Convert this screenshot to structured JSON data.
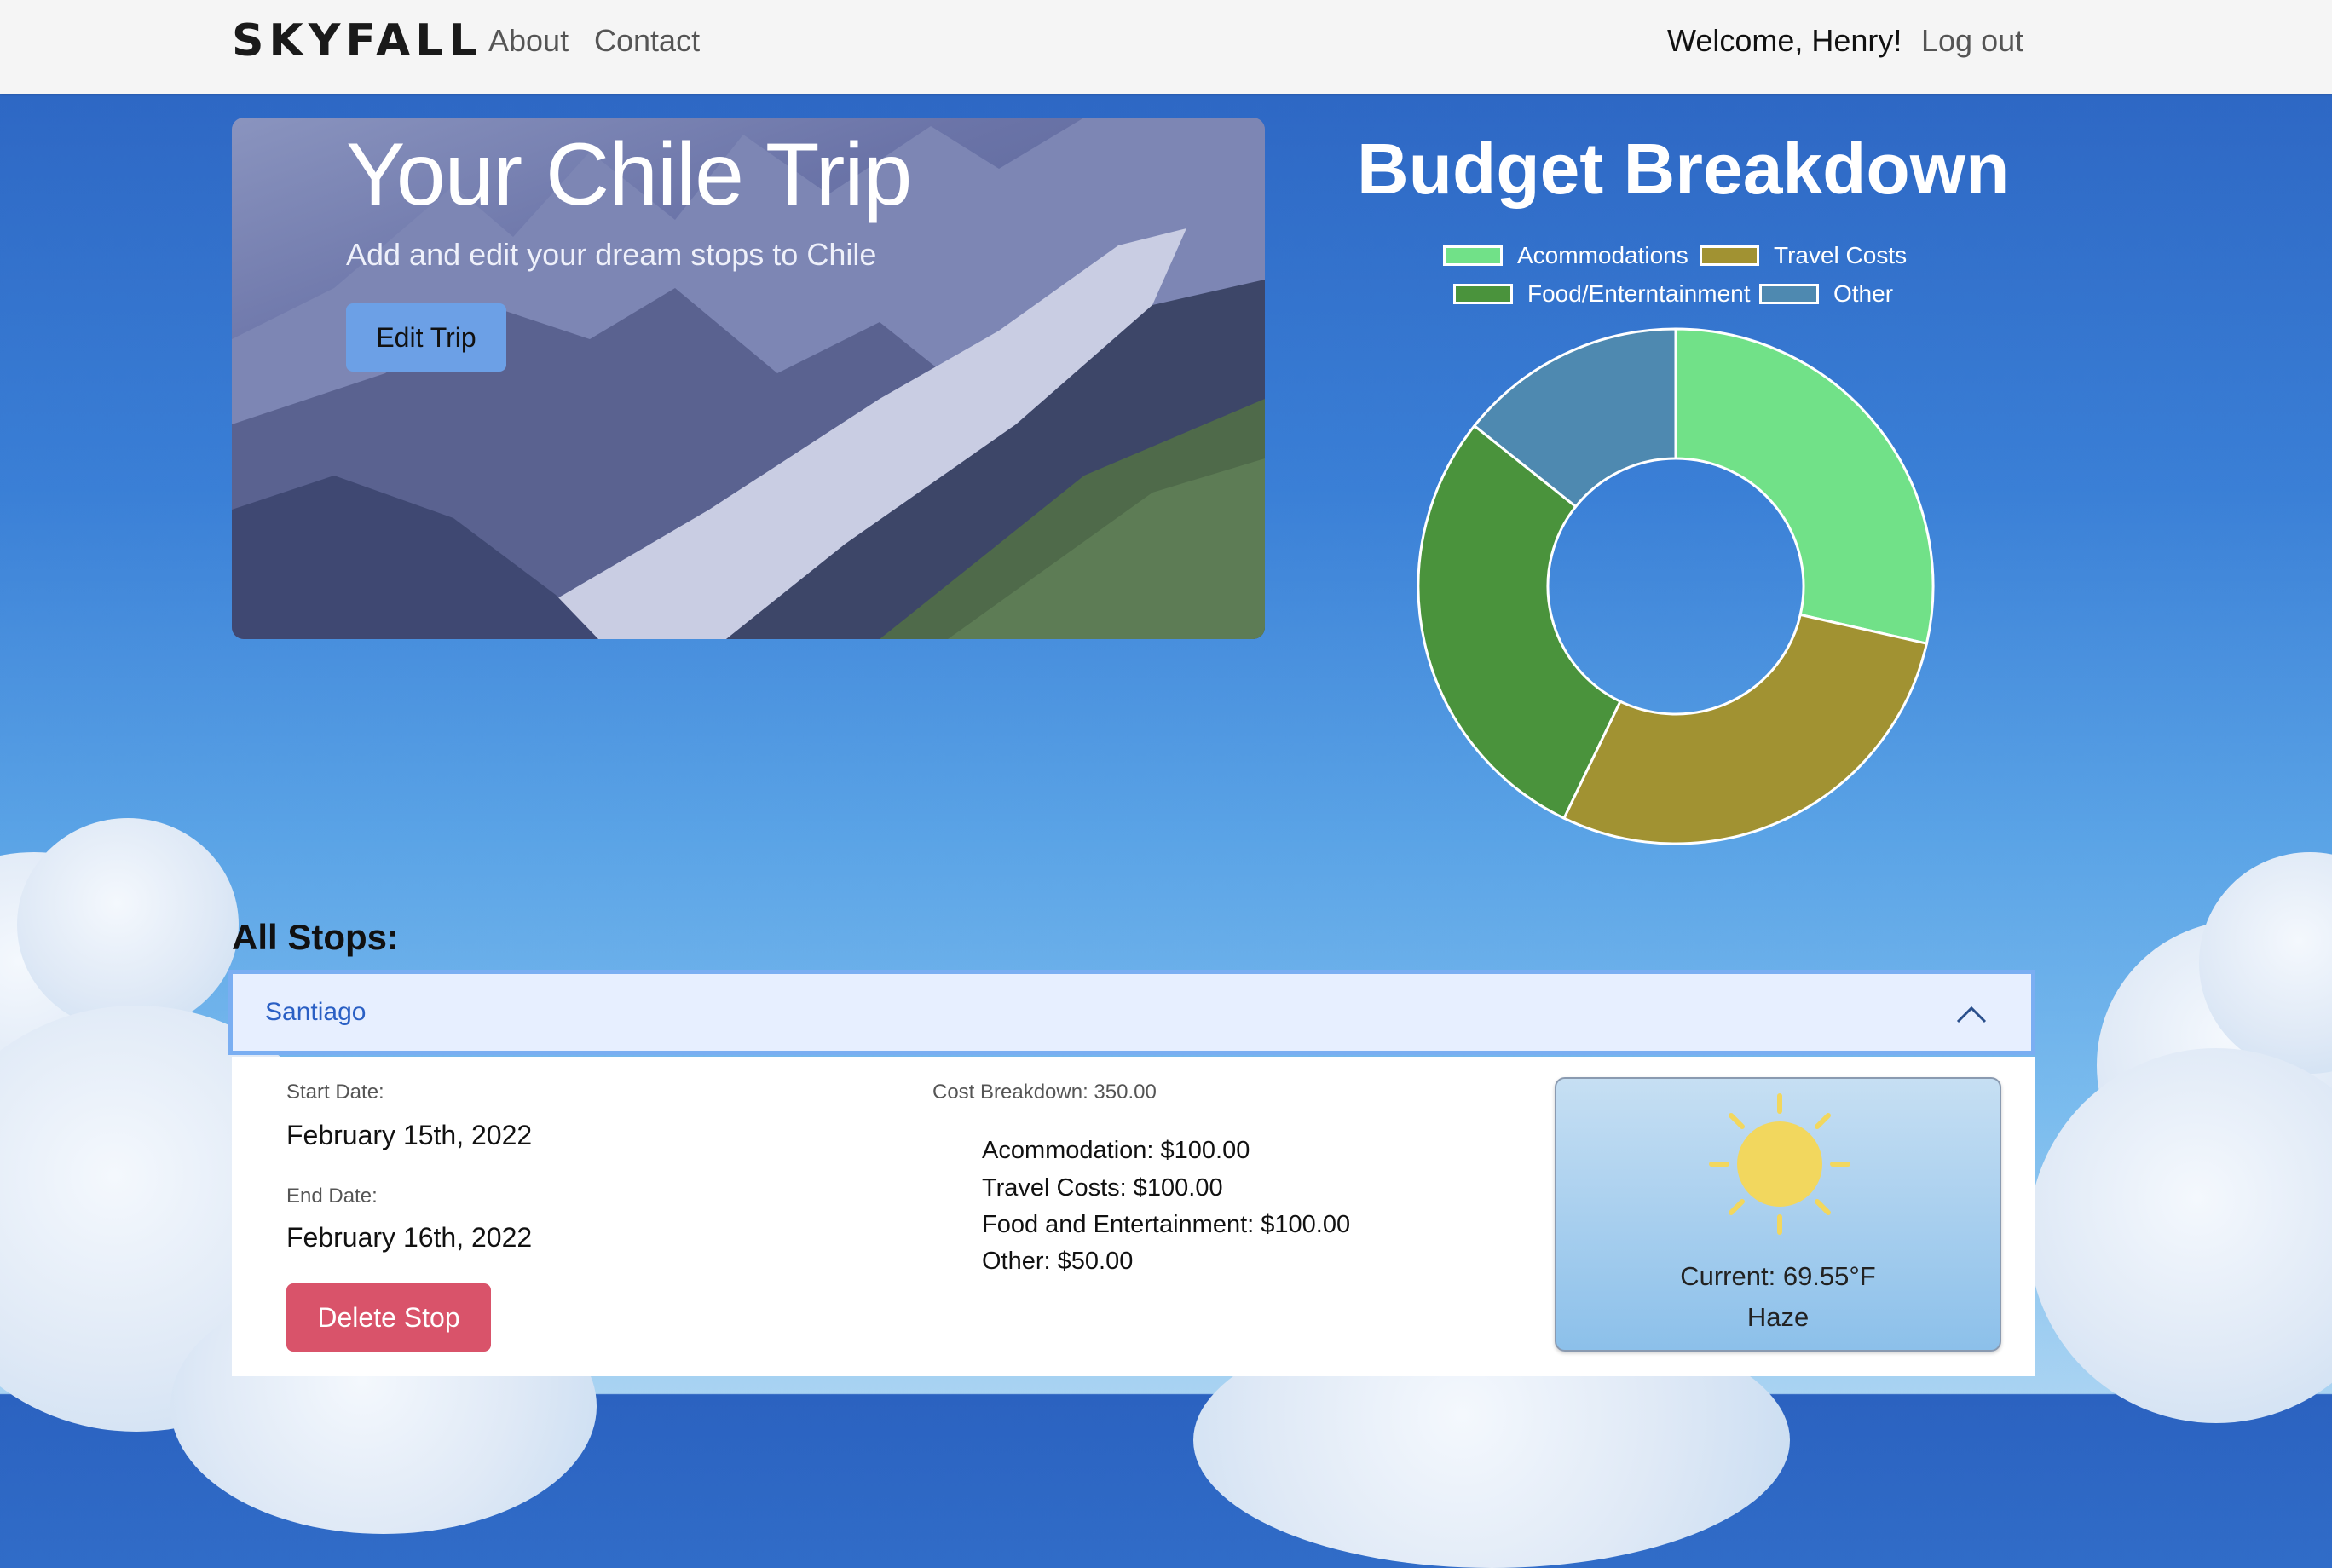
{
  "navbar": {
    "brand": "SKYFALL",
    "links": [
      "About",
      "Contact"
    ],
    "welcome": "Welcome, Henry!",
    "logout": "Log out"
  },
  "hero": {
    "title": "Your Chile Trip",
    "subtitle": "Add and edit your dream stops to Chile",
    "edit_button": "Edit Trip"
  },
  "budget": {
    "title": "Budget Breakdown"
  },
  "chart_data": {
    "type": "pie",
    "donut": true,
    "title": "Budget Breakdown",
    "categories": [
      "Acommodations",
      "Travel Costs",
      "Food/Enterntainment",
      "Other"
    ],
    "values": [
      100,
      100,
      100,
      50
    ],
    "colors": [
      "#71e188",
      "#a19232",
      "#4a933c",
      "#4e89b0"
    ],
    "legend_position": "top"
  },
  "stops": {
    "title": "All Stops:",
    "items": [
      {
        "name": "Santiago",
        "start_label": "Start Date:",
        "start_date": "February 15th, 2022",
        "end_label": "End Date:",
        "end_date": "February 16th, 2022",
        "delete_button": "Delete Stop",
        "cost_label": "Cost Breakdown: 350.00",
        "costs": [
          "Acommodation: $100.00",
          "Travel Costs: $100.00",
          "Food and Entertainment: $100.00",
          "Other: $50.00"
        ],
        "weather": {
          "icon": "sun-icon",
          "current": "Current: 69.55°F",
          "condition": "Haze"
        }
      }
    ]
  }
}
